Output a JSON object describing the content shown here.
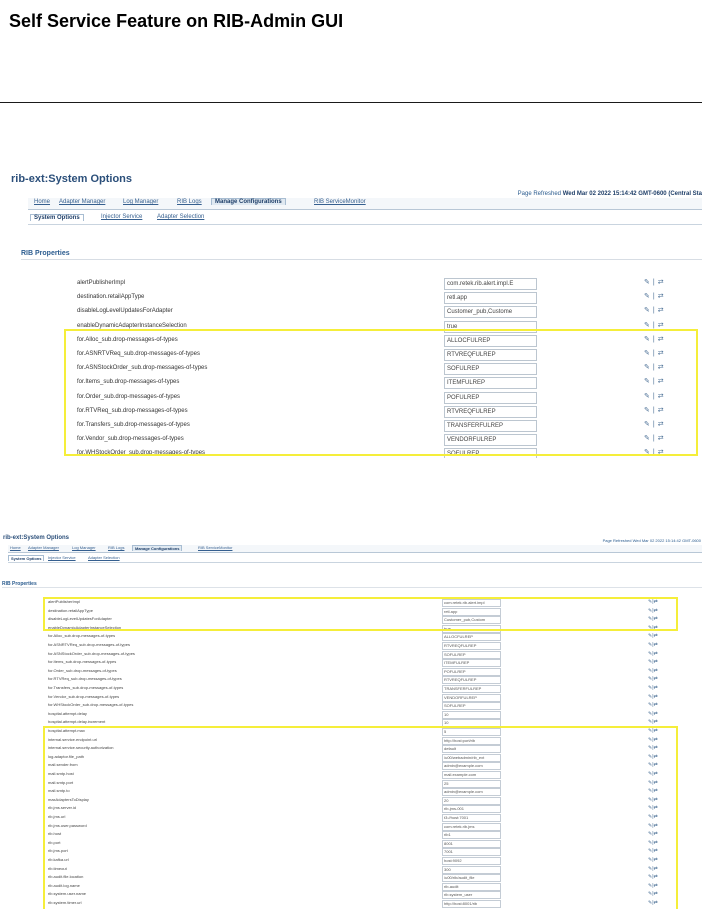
{
  "document": {
    "title": "Self Service Feature on RIB-Admin GUI"
  },
  "screenshot1": {
    "title": "rib-ext:System Options",
    "refresh_label": "Page Refreshed",
    "refresh_time": "Wed Mar 02 2022 15:14:42 GMT-0600 (Central Sta",
    "nav_tabs": [
      "Home",
      "Adapter Manager",
      "Log Manager",
      "RIB Logs",
      "Manage Configurations",
      "RIB ServiceMonitor"
    ],
    "active_nav": "Manage Configurations",
    "sub_tabs": [
      "System Options",
      "Injector Service",
      "Adapter Selection"
    ],
    "active_sub": "System Options",
    "section_title": "RIB Properties",
    "action_icons": [
      "edit-icon",
      "separator",
      "reset-icon"
    ],
    "actions_text": "✎ | ⇄",
    "rows": [
      {
        "name": "alertPublisherImpl",
        "value": "com.retek.rib.alert.impl.E"
      },
      {
        "name": "destination.retailAppType",
        "value": "retl.app"
      },
      {
        "name": "disableLogLevelUpdatesForAdapter",
        "value": "Customer_pub,Custome"
      },
      {
        "name": "enableDynamicAdapterInstanceSelection",
        "value": "true"
      },
      {
        "name": "for.Alloc_sub.drop-messages-of-types",
        "value": "ALLOCFULREP"
      },
      {
        "name": "for.ASNRTVReq_sub.drop-messages-of-types",
        "value": "RTVREQFULREP"
      },
      {
        "name": "for.ASNStockOrder_sub.drop-messages-of-types",
        "value": "SOFULREP"
      },
      {
        "name": "for.Items_sub.drop-messages-of-types",
        "value": "ITEMFULREP"
      },
      {
        "name": "for.Order_sub.drop-messages-of-types",
        "value": "POFULREP"
      },
      {
        "name": "for.RTVReq_sub.drop-messages-of-types",
        "value": "RTVREQFULREP"
      },
      {
        "name": "for.Transfers_sub.drop-messages-of-types",
        "value": "TRANSFERFULREP"
      },
      {
        "name": "for.Vendor_sub.drop-messages-of-types",
        "value": "VENDORFULREP"
      },
      {
        "name": "for.WHStockOrder_sub.drop-messages-of-types",
        "value": "SOFULREP"
      }
    ]
  },
  "screenshot2": {
    "title": "rib-ext:System Options",
    "refresh_text": "Page Refreshed Wed Mar 02 2022 15:14:42 GMT-0600",
    "nav_tabs": [
      "Home",
      "Adapter Manager",
      "Log Manager",
      "RIB Logs",
      "Manage Configurations",
      "RIB ServiceMonitor"
    ],
    "sub_tabs": [
      "System Options",
      "Injector Service",
      "Adapter Selection"
    ],
    "section_title": "RIB Properties",
    "actions_text": "✎ | ⇄",
    "rows": [
      {
        "name": "alertPublisherImpl",
        "value": "com.retek.rib.alert.impl"
      },
      {
        "name": "destination.retailAppType",
        "value": "retl.app"
      },
      {
        "name": "disableLogLevelUpdatesForAdapter",
        "value": "Customer_pub,Custom"
      },
      {
        "name": "enableDynamicAdapterInstanceSelection",
        "value": "true"
      },
      {
        "name": "for.Alloc_sub.drop-messages-of-types",
        "value": "ALLOCFULREP"
      },
      {
        "name": "for.ASNRTVReq_sub.drop-messages-of-types",
        "value": "RTVREQFULREP"
      },
      {
        "name": "for.ASNStockOrder_sub.drop-messages-of-types",
        "value": "SOFULREP"
      },
      {
        "name": "for.Items_sub.drop-messages-of-types",
        "value": "ITEMFULREP"
      },
      {
        "name": "for.Order_sub.drop-messages-of-types",
        "value": "POFULREP"
      },
      {
        "name": "for.RTVReq_sub.drop-messages-of-types",
        "value": "RTVREQFULREP"
      },
      {
        "name": "for.Transfers_sub.drop-messages-of-types",
        "value": "TRANSFERFULREP"
      },
      {
        "name": "for.Vendor_sub.drop-messages-of-types",
        "value": "VENDORFULREP"
      },
      {
        "name": "for.WHStockOrder_sub.drop-messages-of-types",
        "value": "SOFULREP"
      },
      {
        "name": "hospital.attempt.delay",
        "value": "10"
      },
      {
        "name": "hospital.attempt.delay.increment",
        "value": "10"
      },
      {
        "name": "hospital.attempt.max",
        "value": "5"
      },
      {
        "name": "internal.service.endpoint.url",
        "value": "http://host:port/rib"
      },
      {
        "name": "internal.service.security.authorization",
        "value": "default"
      },
      {
        "name": "log.adaptor.file_path",
        "value": "/u00/webadmin/rib_ext"
      },
      {
        "name": "mail.sender.from",
        "value": "admin@example.com"
      },
      {
        "name": "mail.smtp.host",
        "value": "mail.example.com"
      },
      {
        "name": "mail.smtp.port",
        "value": "25"
      },
      {
        "name": "mail.smtp.to",
        "value": "admin@example.com"
      },
      {
        "name": "maxAdaptersToDisplay",
        "value": "20"
      },
      {
        "name": "rib.jms.server.id",
        "value": "rib-jms-001"
      },
      {
        "name": "rib.jms.url",
        "value": "t3://host:7001"
      },
      {
        "name": "rib.jms.user.password",
        "value": "com.retek.rib.jms"
      },
      {
        "name": "rib.host",
        "value": "rib1"
      },
      {
        "name": "rib.port",
        "value": "8001"
      },
      {
        "name": "rib.jms.port",
        "value": "7001"
      },
      {
        "name": "rib.kafka.url",
        "value": "host:9092"
      },
      {
        "name": "rib.timeout",
        "value": "300"
      },
      {
        "name": "rib.audit.file.location",
        "value": "/u00/rib/audit_file"
      },
      {
        "name": "rib.audit.log.name",
        "value": "rib-audit"
      },
      {
        "name": "rib.system.user.name",
        "value": "rib.system_user"
      },
      {
        "name": "rib.system.timer.url",
        "value": "http://host:8001/rib"
      }
    ]
  }
}
